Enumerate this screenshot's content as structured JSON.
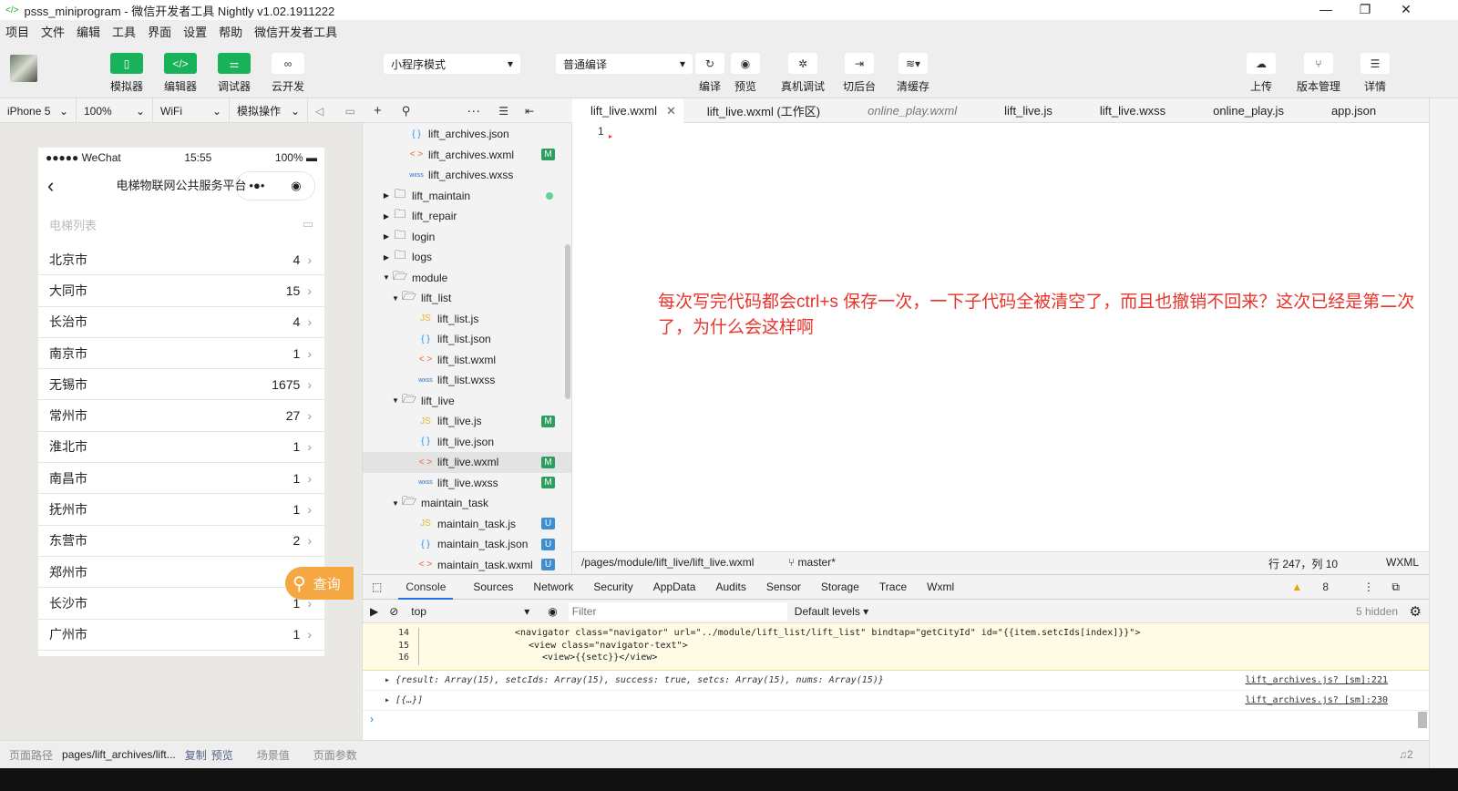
{
  "title": "psss_miniprogram - 微信开发者工具 Nightly v1.02.1911222",
  "menu": [
    "项目",
    "文件",
    "编辑",
    "工具",
    "界面",
    "设置",
    "帮助",
    "微信开发者工具"
  ],
  "toolbar": {
    "simulator": "模拟器",
    "editor": "编辑器",
    "debugger": "调试器",
    "cloud": "云开发",
    "mode": "小程序模式",
    "compile_mode": "普通编译",
    "compile": "编译",
    "preview": "预览",
    "remote_debug": "真机调试",
    "background": "切后台",
    "clear_cache": "清缓存",
    "upload": "上传",
    "version": "版本管理",
    "details": "详情"
  },
  "sim": {
    "device": "iPhone 5",
    "zoom": "100%",
    "network": "WiFi",
    "ops": "模拟操作"
  },
  "phone": {
    "carrier": "●●●●● WeChat",
    "time": "15:55",
    "battery": "100%",
    "nav_title": "电梯物联网公共服务平台",
    "list_header": "电梯列表",
    "query": "查询",
    "cities": [
      {
        "name": "北京市",
        "count": "4"
      },
      {
        "name": "大同市",
        "count": "15"
      },
      {
        "name": "长治市",
        "count": "4"
      },
      {
        "name": "南京市",
        "count": "1"
      },
      {
        "name": "无锡市",
        "count": "1675"
      },
      {
        "name": "常州市",
        "count": "27"
      },
      {
        "name": "淮北市",
        "count": "1"
      },
      {
        "name": "南昌市",
        "count": "1"
      },
      {
        "name": "抚州市",
        "count": "1"
      },
      {
        "name": "东营市",
        "count": "2"
      },
      {
        "name": "郑州市",
        "count": ""
      },
      {
        "name": "长沙市",
        "count": "1"
      },
      {
        "name": "广州市",
        "count": "1"
      }
    ]
  },
  "tree": [
    {
      "name": "lift_archives.json",
      "type": "json",
      "depth": 2
    },
    {
      "name": "lift_archives.wxml",
      "type": "wxml",
      "depth": 2,
      "badge": "M"
    },
    {
      "name": "lift_archives.wxss",
      "type": "wxss",
      "depth": 2
    },
    {
      "name": "lift_maintain",
      "type": "folder",
      "depth": 1,
      "dot": true
    },
    {
      "name": "lift_repair",
      "type": "folder",
      "depth": 1
    },
    {
      "name": "login",
      "type": "folder",
      "depth": 1
    },
    {
      "name": "logs",
      "type": "folder",
      "depth": 1
    },
    {
      "name": "module",
      "type": "folder-open",
      "depth": 1
    },
    {
      "name": "lift_list",
      "type": "folder-open",
      "depth": 2
    },
    {
      "name": "lift_list.js",
      "type": "js",
      "depth": 3
    },
    {
      "name": "lift_list.json",
      "type": "json",
      "depth": 3
    },
    {
      "name": "lift_list.wxml",
      "type": "wxml",
      "depth": 3
    },
    {
      "name": "lift_list.wxss",
      "type": "wxss",
      "depth": 3
    },
    {
      "name": "lift_live",
      "type": "folder-open",
      "depth": 2
    },
    {
      "name": "lift_live.js",
      "type": "js",
      "depth": 3,
      "badge": "M"
    },
    {
      "name": "lift_live.json",
      "type": "json",
      "depth": 3
    },
    {
      "name": "lift_live.wxml",
      "type": "wxml",
      "depth": 3,
      "badge": "M",
      "selected": true
    },
    {
      "name": "lift_live.wxss",
      "type": "wxss",
      "depth": 3,
      "badge": "M"
    },
    {
      "name": "maintain_task",
      "type": "folder-open",
      "depth": 2
    },
    {
      "name": "maintain_task.js",
      "type": "js",
      "depth": 3,
      "badge": "U"
    },
    {
      "name": "maintain_task.json",
      "type": "json",
      "depth": 3,
      "badge": "U"
    },
    {
      "name": "maintain_task.wxml",
      "type": "wxml",
      "depth": 3,
      "badge": "U"
    }
  ],
  "tabs": [
    {
      "label": "lift_live.wxml",
      "active": true
    },
    {
      "label": "lift_live.wxml (工作区)"
    },
    {
      "label": "online_play.wxml",
      "italic": true
    },
    {
      "label": "lift_live.js"
    },
    {
      "label": "lift_live.wxss"
    },
    {
      "label": "online_play.js"
    },
    {
      "label": "app.json"
    }
  ],
  "editor": {
    "line": "1",
    "note": "每次写完代码都会ctrl+s 保存一次，一下子代码全被清空了，而且也撤销不回来？这次已经是第二次了，为什么会这样啊"
  },
  "edstatus": {
    "path": "/pages/module/lift_live/lift_live.wxml",
    "branch": "master*",
    "position": "行 247，列 10",
    "lang": "WXML"
  },
  "devtools": {
    "tabs": [
      "Console",
      "Sources",
      "Network",
      "Security",
      "AppData",
      "Audits",
      "Sensor",
      "Storage",
      "Trace",
      "Wxml"
    ],
    "warnings": "8",
    "context": "top",
    "filter_placeholder": "Filter",
    "levels": "Default levels ▾",
    "hidden": "5 hidden",
    "code": [
      {
        "ln": "14",
        "text": "<navigator class=\"navigator\" url=\"../module/lift_list/lift_list\" bindtap=\"getCityId\" id=\"{{item.setcIds[index]}}\">",
        "indent": 14
      },
      {
        "ln": "15",
        "text": "<view class=\"navigator-text\">",
        "indent": 16
      },
      {
        "ln": "16",
        "text": "<view>{{setc}}</view>",
        "indent": 18
      }
    ],
    "logs": [
      {
        "text": "{result: Array(15), setcIds: Array(15), success: true, setcs: Array(15), nums: Array(15)}",
        "src": "lift_archives.js? [sm]:221"
      },
      {
        "text": "[{…}]",
        "src": "lift_archives.js? [sm]:230"
      }
    ],
    "prompt": "›"
  },
  "bottom": {
    "path_label": "页面路径",
    "path": "pages/lift_archives/lift...",
    "copy": "复制",
    "preview": "预览",
    "scene": "场景值",
    "params": "页面参数",
    "notifications": "2"
  }
}
